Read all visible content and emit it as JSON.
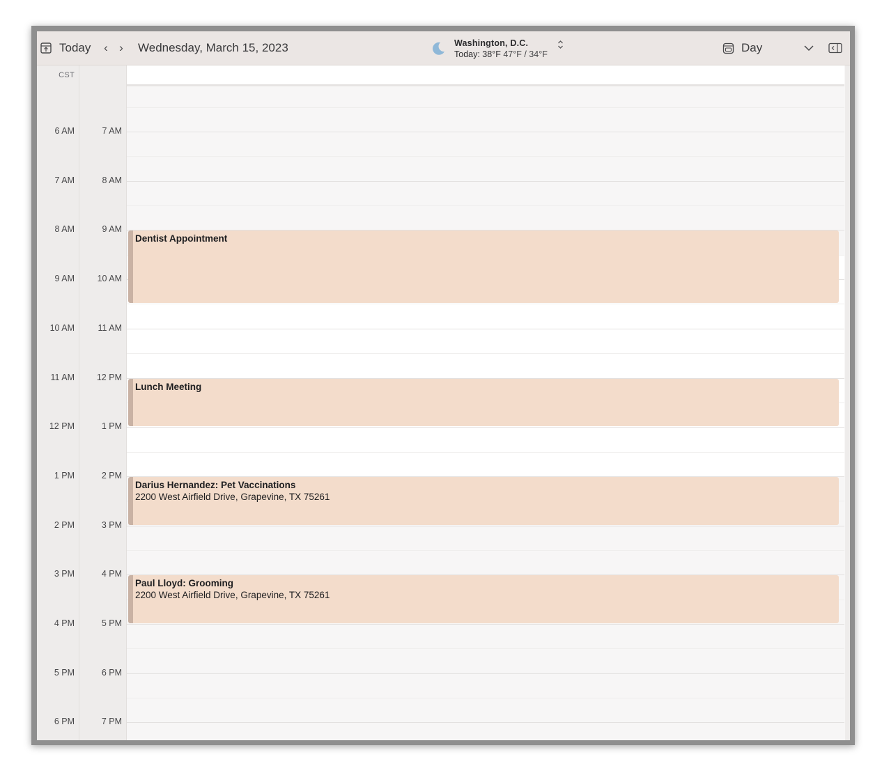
{
  "toolbar": {
    "today_label": "Today",
    "date_title": "Wednesday, March 15, 2023",
    "weather": {
      "city": "Washington,  D.C.",
      "today_prefix": "Today: 38°F",
      "high_low": "47°F / 34°F",
      "icon": "moon-icon"
    },
    "view_label": "Day"
  },
  "time_columns": {
    "secondary_tz_label": "CST",
    "secondary_hours": [
      "6 AM",
      "7 AM",
      "8 AM",
      "9 AM",
      "10 AM",
      "11 AM",
      "12 PM",
      "1 PM",
      "2 PM",
      "3 PM",
      "4 PM",
      "5 PM",
      "6 PM"
    ],
    "local_hours": [
      "7 AM",
      "8 AM",
      "9 AM",
      "10 AM",
      "11 AM",
      "12 PM",
      "1 PM",
      "2 PM",
      "3 PM",
      "4 PM",
      "5 PM",
      "6 PM",
      "7 PM"
    ]
  },
  "events": [
    {
      "title": "Dentist Appointment",
      "location": ""
    },
    {
      "title": "Lunch Meeting",
      "location": ""
    },
    {
      "title": "Darius Hernandez: Pet Vaccinations",
      "location": "2200 West Airfield Drive, Grapevine, TX 75261"
    },
    {
      "title": "Paul Lloyd: Grooming",
      "location": "2200 West Airfield Drive, Grapevine, TX 75261"
    }
  ],
  "colors": {
    "event_fill": "#f3dccb",
    "event_bar": "#c9b2a4",
    "toolbar_bg": "#ebe6e4"
  }
}
